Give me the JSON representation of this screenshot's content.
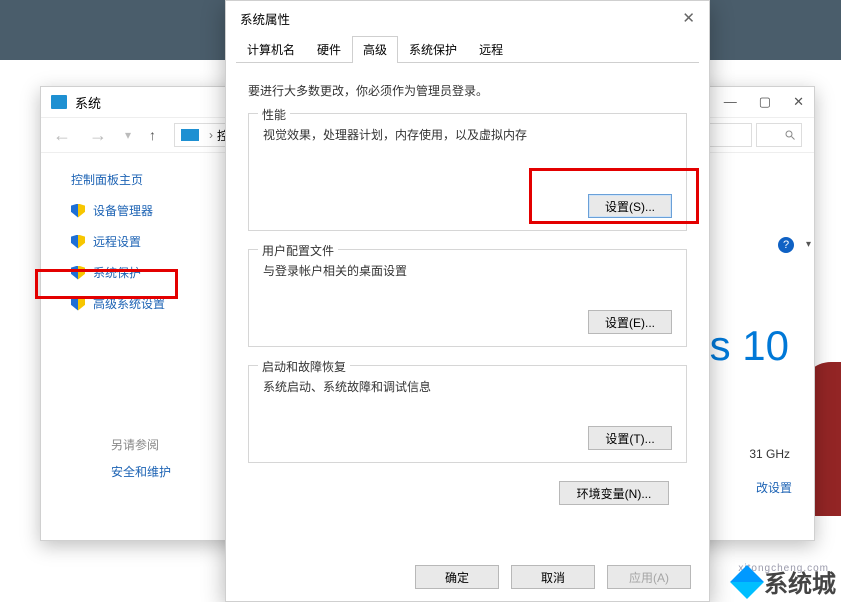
{
  "system_window": {
    "title": "系统",
    "breadcrumb": [
      "控制面"
    ],
    "help_icon": "?",
    "sidebar": {
      "header": "控制面板主页",
      "items": [
        {
          "label": "设备管理器"
        },
        {
          "label": "远程设置"
        },
        {
          "label": "系统保护"
        },
        {
          "label": "高级系统设置"
        }
      ]
    },
    "see_also": {
      "header": "另请参阅",
      "items": [
        "安全和维护"
      ]
    },
    "right_panel": {
      "brand_fragment": "/s 10",
      "spec_fragment": "31 GHz",
      "link": "改设置"
    }
  },
  "dialog": {
    "title": "系统属性",
    "tabs": [
      "计算机名",
      "硬件",
      "高级",
      "系统保护",
      "远程"
    ],
    "active_tab": 2,
    "note": "要进行大多数更改，你必须作为管理员登录。",
    "groups": [
      {
        "title": "性能",
        "desc": "视觉效果，处理器计划，内存使用，以及虚拟内存",
        "button": "设置(S)..."
      },
      {
        "title": "用户配置文件",
        "desc": "与登录帐户相关的桌面设置",
        "button": "设置(E)..."
      },
      {
        "title": "启动和故障恢复",
        "desc": "系统启动、系统故障和调试信息",
        "button": "设置(T)..."
      }
    ],
    "env_button": "环境变量(N)...",
    "ok": "确定",
    "cancel": "取消",
    "apply": "应用(A)"
  },
  "watermark": "系统城",
  "watermark_url": "xitongcheng.com"
}
